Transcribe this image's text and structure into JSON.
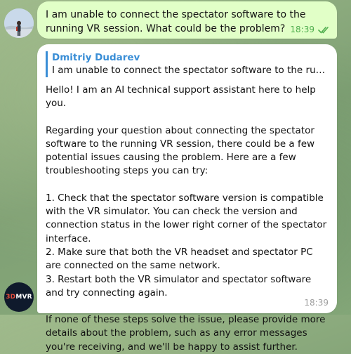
{
  "messages": {
    "outgoing": {
      "text": "I am unable to connect the spectator software to the running VR session. What could be the problem?",
      "time": "18:39",
      "status_icon": "double-check-icon",
      "avatar_icon": "user-avatar-photo"
    },
    "incoming": {
      "reply_author": "Dmitriy Dudarev",
      "reply_quote": "I am unable to connect the spectator software to the running VR...",
      "paragraphs": [
        "Hello! I am an AI technical support assistant here to help you.",
        "Regarding your question about connecting the spectator software to the running VR session, there could be a few potential issues causing the problem. Here are a few troubleshooting steps you can try:",
        "1. Check that the spectator software version is compatible with the VR simulator. You can check the version and connection status in the lower right corner of the spectator interface.",
        "2. Make sure that both the VR headset and spectator PC are connected on the same network.",
        "3. Restart both the VR simulator and spectator software and try connecting again.",
        "If none of these steps solve the issue, please provide more details about the problem, such as any error messages you're receiving, and we'll be happy to assist further."
      ],
      "time": "18:39",
      "avatar_logo_prefix": "3D",
      "avatar_logo_suffix": "MVR"
    }
  },
  "colors": {
    "outgoing_bubble": "#e1ffc7",
    "incoming_bubble": "#ffffff",
    "reply_accent": "#3a8ed6",
    "read_check": "#4fae4e"
  }
}
